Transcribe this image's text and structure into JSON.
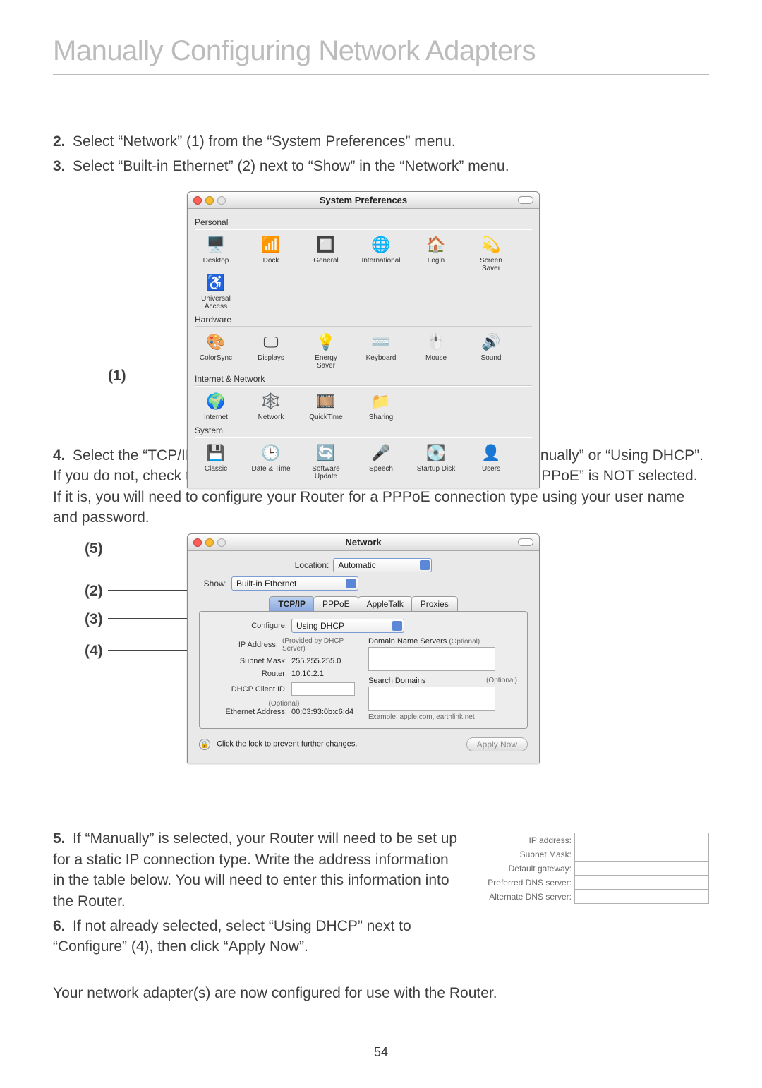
{
  "title": "Manually Configuring Network Adapters",
  "page_number": "54",
  "steps": {
    "s2": "Select “Network” (1) from the “System Preferences” menu.",
    "s3": "Select “Built-in Ethernet” (2) next to “Show” in the “Network” menu.",
    "s4": "Select the “TCP/IP” tab (3). Next to “Configure” (4), you should see “Manually” or “Using DHCP”. If you do not, check the PPPoE tab (5) to make sure that “Connect using PPPoE” is NOT selected. If it is, you will need to configure your Router for a PPPoE connection type using your user name and password.",
    "s5": "If “Manually” is selected, your Router will need to be set up for a static IP connection type. Write the address information in the table below. You will need to enter this information into the Router.",
    "s6": "If not already selected, select “Using DHCP” next to “Configure” (4), then click “Apply Now”.",
    "closing": "Your network adapter(s) are now configured for use with the Router."
  },
  "callouts": {
    "c1": "(1)",
    "c2": "(2)",
    "c3": "(3)",
    "c4": "(4)",
    "c5": "(5)"
  },
  "prefs_window": {
    "title": "System Preferences",
    "sections": {
      "personal": "Personal",
      "hardware": "Hardware",
      "internet": "Internet & Network",
      "system": "System"
    },
    "items": {
      "desktop": "Desktop",
      "dock": "Dock",
      "general": "General",
      "international": "International",
      "login": "Login",
      "screensaver": "Screen Saver",
      "universal": "Universal Access",
      "colorsync": "ColorSync",
      "displays": "Displays",
      "energy": "Energy Saver",
      "keyboard": "Keyboard",
      "mouse": "Mouse",
      "sound": "Sound",
      "internet_item": "Internet",
      "network": "Network",
      "quicktime": "QuickTime",
      "sharing": "Sharing",
      "classic": "Classic",
      "datetime": "Date & Time",
      "software": "Software Update",
      "speech": "Speech",
      "startup": "Startup Disk",
      "users": "Users"
    }
  },
  "network_window": {
    "title": "Network",
    "location_label": "Location:",
    "location_value": "Automatic",
    "show_label": "Show:",
    "show_value": "Built-in Ethernet",
    "tabs": {
      "tcpip": "TCP/IP",
      "pppoe": "PPPoE",
      "appletalk": "AppleTalk",
      "proxies": "Proxies"
    },
    "configure_label": "Configure:",
    "configure_value": "Using DHCP",
    "dns_label": "Domain Name Servers",
    "optional": "(Optional)",
    "ip_label": "IP Address:",
    "ip_note": "(Provided by DHCP Server)",
    "subnet_label": "Subnet Mask:",
    "subnet_value": "255.255.255.0",
    "router_label": "Router:",
    "router_value": "10.10.2.1",
    "search_label": "Search Domains",
    "dhcp_label": "DHCP Client ID:",
    "dhcp_note": "(Optional)",
    "eth_label": "Ethernet Address:",
    "eth_value": "00:03:93:0b:c6:d4",
    "example": "Example: apple.com, earthlink.net",
    "lock_text": "Click the lock to prevent further changes.",
    "apply": "Apply Now"
  },
  "ip_table": {
    "ip": "IP address:",
    "subnet": "Subnet Mask:",
    "gateway": "Default gateway:",
    "dns1": "Preferred DNS server:",
    "dns2": "Alternate DNS server:"
  }
}
